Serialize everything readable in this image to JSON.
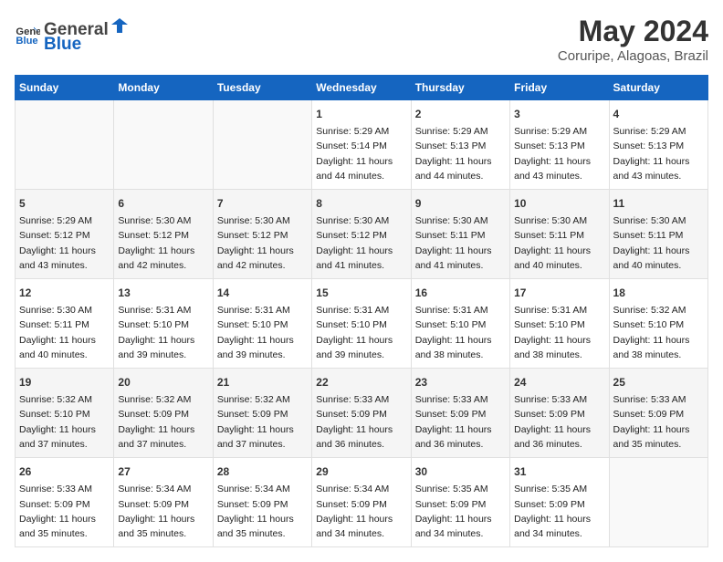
{
  "header": {
    "logo_general": "General",
    "logo_blue": "Blue",
    "title": "May 2024",
    "subtitle": "Coruripe, Alagoas, Brazil"
  },
  "days_of_week": [
    "Sunday",
    "Monday",
    "Tuesday",
    "Wednesday",
    "Thursday",
    "Friday",
    "Saturday"
  ],
  "weeks": [
    [
      {
        "day": "",
        "sunrise": "",
        "sunset": "",
        "daylight": ""
      },
      {
        "day": "",
        "sunrise": "",
        "sunset": "",
        "daylight": ""
      },
      {
        "day": "",
        "sunrise": "",
        "sunset": "",
        "daylight": ""
      },
      {
        "day": "1",
        "sunrise": "Sunrise: 5:29 AM",
        "sunset": "Sunset: 5:14 PM",
        "daylight": "Daylight: 11 hours and 44 minutes."
      },
      {
        "day": "2",
        "sunrise": "Sunrise: 5:29 AM",
        "sunset": "Sunset: 5:13 PM",
        "daylight": "Daylight: 11 hours and 44 minutes."
      },
      {
        "day": "3",
        "sunrise": "Sunrise: 5:29 AM",
        "sunset": "Sunset: 5:13 PM",
        "daylight": "Daylight: 11 hours and 43 minutes."
      },
      {
        "day": "4",
        "sunrise": "Sunrise: 5:29 AM",
        "sunset": "Sunset: 5:13 PM",
        "daylight": "Daylight: 11 hours and 43 minutes."
      }
    ],
    [
      {
        "day": "5",
        "sunrise": "Sunrise: 5:29 AM",
        "sunset": "Sunset: 5:12 PM",
        "daylight": "Daylight: 11 hours and 43 minutes."
      },
      {
        "day": "6",
        "sunrise": "Sunrise: 5:30 AM",
        "sunset": "Sunset: 5:12 PM",
        "daylight": "Daylight: 11 hours and 42 minutes."
      },
      {
        "day": "7",
        "sunrise": "Sunrise: 5:30 AM",
        "sunset": "Sunset: 5:12 PM",
        "daylight": "Daylight: 11 hours and 42 minutes."
      },
      {
        "day": "8",
        "sunrise": "Sunrise: 5:30 AM",
        "sunset": "Sunset: 5:12 PM",
        "daylight": "Daylight: 11 hours and 41 minutes."
      },
      {
        "day": "9",
        "sunrise": "Sunrise: 5:30 AM",
        "sunset": "Sunset: 5:11 PM",
        "daylight": "Daylight: 11 hours and 41 minutes."
      },
      {
        "day": "10",
        "sunrise": "Sunrise: 5:30 AM",
        "sunset": "Sunset: 5:11 PM",
        "daylight": "Daylight: 11 hours and 40 minutes."
      },
      {
        "day": "11",
        "sunrise": "Sunrise: 5:30 AM",
        "sunset": "Sunset: 5:11 PM",
        "daylight": "Daylight: 11 hours and 40 minutes."
      }
    ],
    [
      {
        "day": "12",
        "sunrise": "Sunrise: 5:30 AM",
        "sunset": "Sunset: 5:11 PM",
        "daylight": "Daylight: 11 hours and 40 minutes."
      },
      {
        "day": "13",
        "sunrise": "Sunrise: 5:31 AM",
        "sunset": "Sunset: 5:10 PM",
        "daylight": "Daylight: 11 hours and 39 minutes."
      },
      {
        "day": "14",
        "sunrise": "Sunrise: 5:31 AM",
        "sunset": "Sunset: 5:10 PM",
        "daylight": "Daylight: 11 hours and 39 minutes."
      },
      {
        "day": "15",
        "sunrise": "Sunrise: 5:31 AM",
        "sunset": "Sunset: 5:10 PM",
        "daylight": "Daylight: 11 hours and 39 minutes."
      },
      {
        "day": "16",
        "sunrise": "Sunrise: 5:31 AM",
        "sunset": "Sunset: 5:10 PM",
        "daylight": "Daylight: 11 hours and 38 minutes."
      },
      {
        "day": "17",
        "sunrise": "Sunrise: 5:31 AM",
        "sunset": "Sunset: 5:10 PM",
        "daylight": "Daylight: 11 hours and 38 minutes."
      },
      {
        "day": "18",
        "sunrise": "Sunrise: 5:32 AM",
        "sunset": "Sunset: 5:10 PM",
        "daylight": "Daylight: 11 hours and 38 minutes."
      }
    ],
    [
      {
        "day": "19",
        "sunrise": "Sunrise: 5:32 AM",
        "sunset": "Sunset: 5:10 PM",
        "daylight": "Daylight: 11 hours and 37 minutes."
      },
      {
        "day": "20",
        "sunrise": "Sunrise: 5:32 AM",
        "sunset": "Sunset: 5:09 PM",
        "daylight": "Daylight: 11 hours and 37 minutes."
      },
      {
        "day": "21",
        "sunrise": "Sunrise: 5:32 AM",
        "sunset": "Sunset: 5:09 PM",
        "daylight": "Daylight: 11 hours and 37 minutes."
      },
      {
        "day": "22",
        "sunrise": "Sunrise: 5:33 AM",
        "sunset": "Sunset: 5:09 PM",
        "daylight": "Daylight: 11 hours and 36 minutes."
      },
      {
        "day": "23",
        "sunrise": "Sunrise: 5:33 AM",
        "sunset": "Sunset: 5:09 PM",
        "daylight": "Daylight: 11 hours and 36 minutes."
      },
      {
        "day": "24",
        "sunrise": "Sunrise: 5:33 AM",
        "sunset": "Sunset: 5:09 PM",
        "daylight": "Daylight: 11 hours and 36 minutes."
      },
      {
        "day": "25",
        "sunrise": "Sunrise: 5:33 AM",
        "sunset": "Sunset: 5:09 PM",
        "daylight": "Daylight: 11 hours and 35 minutes."
      }
    ],
    [
      {
        "day": "26",
        "sunrise": "Sunrise: 5:33 AM",
        "sunset": "Sunset: 5:09 PM",
        "daylight": "Daylight: 11 hours and 35 minutes."
      },
      {
        "day": "27",
        "sunrise": "Sunrise: 5:34 AM",
        "sunset": "Sunset: 5:09 PM",
        "daylight": "Daylight: 11 hours and 35 minutes."
      },
      {
        "day": "28",
        "sunrise": "Sunrise: 5:34 AM",
        "sunset": "Sunset: 5:09 PM",
        "daylight": "Daylight: 11 hours and 35 minutes."
      },
      {
        "day": "29",
        "sunrise": "Sunrise: 5:34 AM",
        "sunset": "Sunset: 5:09 PM",
        "daylight": "Daylight: 11 hours and 34 minutes."
      },
      {
        "day": "30",
        "sunrise": "Sunrise: 5:35 AM",
        "sunset": "Sunset: 5:09 PM",
        "daylight": "Daylight: 11 hours and 34 minutes."
      },
      {
        "day": "31",
        "sunrise": "Sunrise: 5:35 AM",
        "sunset": "Sunset: 5:09 PM",
        "daylight": "Daylight: 11 hours and 34 minutes."
      },
      {
        "day": "",
        "sunrise": "",
        "sunset": "",
        "daylight": ""
      }
    ]
  ]
}
